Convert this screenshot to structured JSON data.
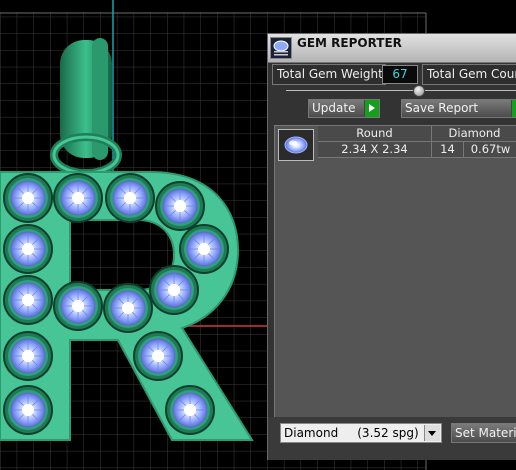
{
  "panel": {
    "title": "GEM REPORTER",
    "total_gem_weight_label": "Total Gem Weight",
    "total_gem_weight_value": "67",
    "total_gem_count_label": "Total Gem Count",
    "update_label": "Update",
    "save_report_label": "Save Report",
    "columns": [
      "Round",
      "Diamond"
    ],
    "rows": [
      {
        "size": "2.34 X 2.34",
        "count": "14",
        "weight": "0.67tw"
      }
    ],
    "material_select": "Diamond     (3.52 spg)",
    "set_material_label": "Set Material"
  },
  "colors": {
    "model": "#48c596",
    "gem": "#8fa8ff",
    "accent": "#14a01c",
    "readout": "#3fd3d6"
  },
  "icons": [
    "gem-reporter-app-icon",
    "play-icon",
    "chevron-down-icon",
    "round-gem-icon"
  ]
}
